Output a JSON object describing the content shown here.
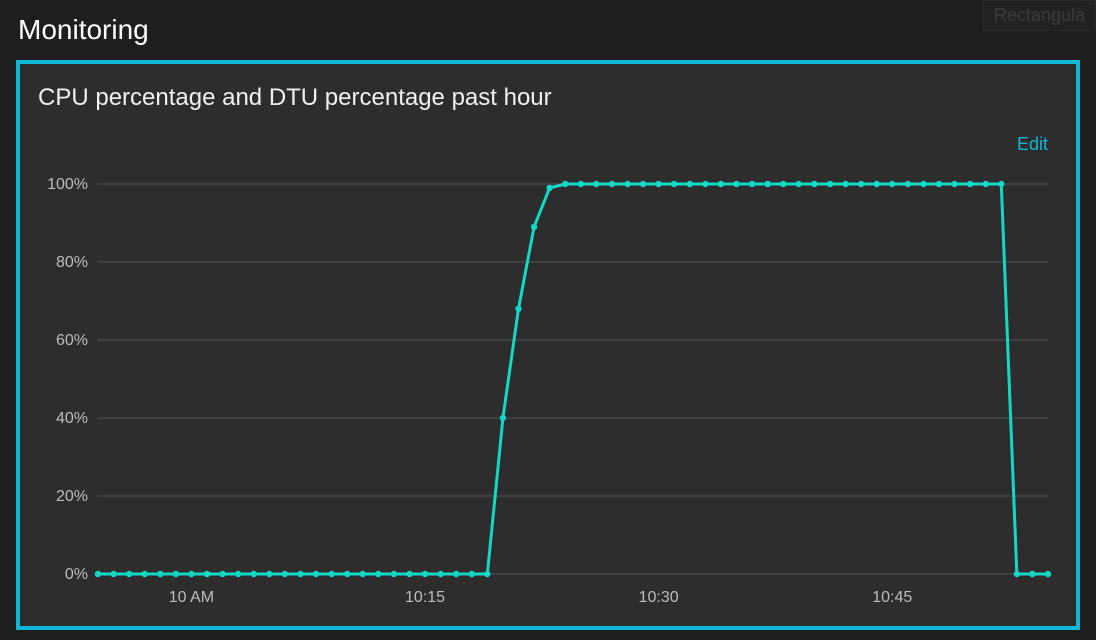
{
  "page_title": "Monitoring",
  "ghost_button_label": "Rectangula",
  "tile": {
    "title": "CPU percentage and DTU percentage past hour",
    "edit_label": "Edit"
  },
  "accent_color": "#13d8c8",
  "chart_data": {
    "type": "line",
    "title": "CPU percentage and DTU percentage past hour",
    "ylabel": "",
    "xlabel": "",
    "ylim": [
      0,
      100
    ],
    "y_ticks": [
      0,
      20,
      40,
      60,
      80,
      100
    ],
    "y_tick_labels": [
      "0%",
      "20%",
      "40%",
      "60%",
      "80%",
      "100%"
    ],
    "x_tick_labels": [
      "10 AM",
      "10:15",
      "10:30",
      "10:45"
    ],
    "x_tick_positions": [
      6,
      21,
      36,
      51
    ],
    "n_points": 62,
    "series": [
      {
        "name": "percentage",
        "color": "#13d8c8",
        "values": [
          0,
          0,
          0,
          0,
          0,
          0,
          0,
          0,
          0,
          0,
          0,
          0,
          0,
          0,
          0,
          0,
          0,
          0,
          0,
          0,
          0,
          0,
          0,
          0,
          0,
          0,
          40,
          68,
          89,
          99,
          100,
          100,
          100,
          100,
          100,
          100,
          100,
          100,
          100,
          100,
          100,
          100,
          100,
          100,
          100,
          100,
          100,
          100,
          100,
          100,
          100,
          100,
          100,
          100,
          100,
          100,
          100,
          100,
          100,
          0,
          0,
          0
        ]
      }
    ]
  }
}
